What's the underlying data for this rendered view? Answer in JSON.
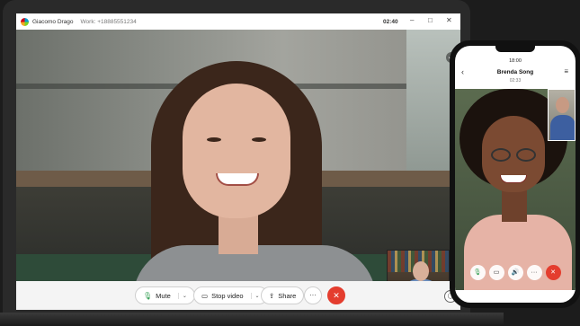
{
  "window": {
    "caller_name": "Giacomo Drago",
    "work_label": "Work: +18885551234",
    "call_time": "02:40",
    "minimize_icon": "–",
    "maximize_icon": "□",
    "close_icon": "✕"
  },
  "controls": {
    "mute_label": "Mute",
    "stop_video_label": "Stop video",
    "share_label": "Share",
    "more_label": "···",
    "end_call_icon": "✕",
    "caret": "⌄",
    "mic_icon": "🎙",
    "video_icon": "▭",
    "share_icon": "⇪",
    "chat_icon": "◯"
  },
  "phone": {
    "status_time": "18:00",
    "contact_name": "Brenda Song",
    "call_duration": "02:33",
    "back_icon": "‹",
    "menu_icon": "≡",
    "buttons": [
      "mic",
      "video",
      "speaker",
      "more",
      "end"
    ]
  },
  "colors": {
    "end_call": "#e43d2e",
    "mic_active": "#2f9c4f"
  }
}
